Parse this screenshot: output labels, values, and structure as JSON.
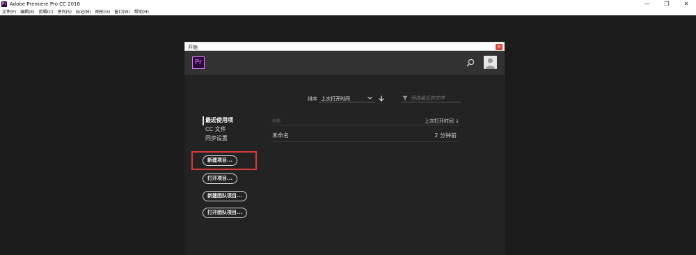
{
  "window": {
    "title": "Adobe Premiere Pro CC 2018",
    "app_logo_text": "Pr",
    "controls": {
      "minimize": "—",
      "restore": "❐",
      "close": "✕"
    }
  },
  "menu": [
    "文件(F)",
    "编辑(E)",
    "剪辑(C)",
    "序列(S)",
    "标记(M)",
    "图形(G)",
    "窗口(W)",
    "帮助(H)"
  ],
  "dialog": {
    "title": "开始",
    "close_glyph": "×",
    "logo_text": "Pr",
    "sort": {
      "label": "排序",
      "selected": "上次打开时间"
    },
    "filter": {
      "placeholder": "筛选最近的文件"
    },
    "nav": [
      "最近使用项",
      "CC 文件",
      "同步设置"
    ],
    "buttons": [
      "新建项目...",
      "打开项目...",
      "新建团队项目...",
      "打开团队项目..."
    ],
    "list": {
      "col_name": "名称",
      "col_date": "上次打开时间 ↓",
      "rows": [
        {
          "name": "未命名",
          "date": "2 分钟前"
        }
      ]
    }
  },
  "colors": {
    "background": "#1b1b1b",
    "dialog": "#232323",
    "header": "#323232",
    "highlight": "#d93a3a",
    "brand": "#e77bff"
  }
}
